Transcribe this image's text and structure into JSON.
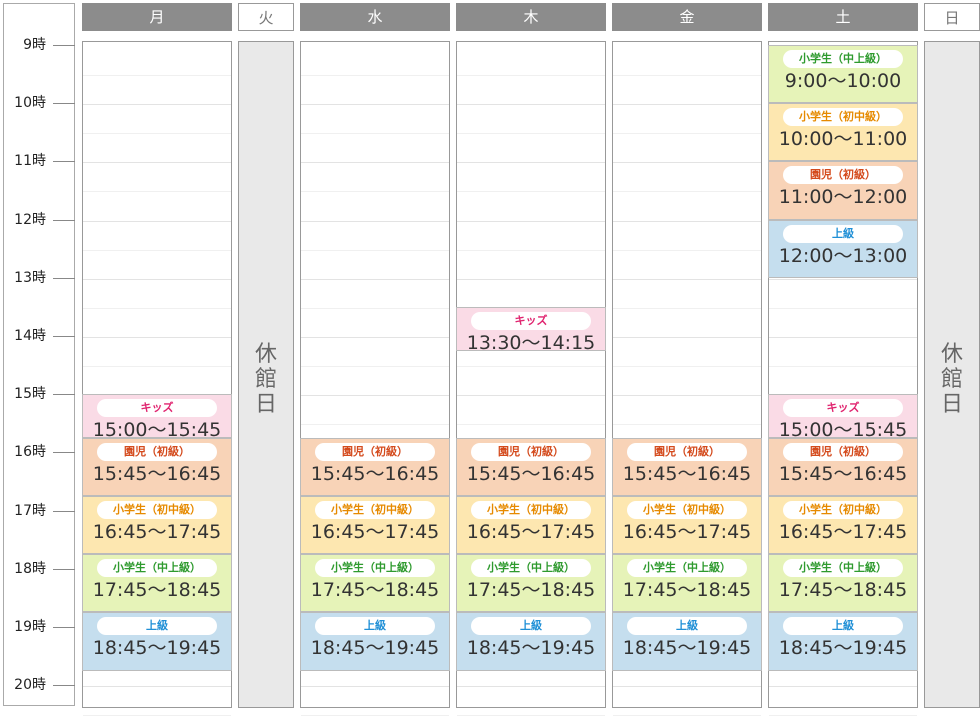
{
  "days": [
    {
      "label": "月",
      "closed": false
    },
    {
      "label": "火",
      "closed": true
    },
    {
      "label": "水",
      "closed": false
    },
    {
      "label": "木",
      "closed": false
    },
    {
      "label": "金",
      "closed": false
    },
    {
      "label": "土",
      "closed": false
    },
    {
      "label": "日",
      "closed": true
    }
  ],
  "hours": [
    "9時",
    "10時",
    "11時",
    "12時",
    "13時",
    "14時",
    "15時",
    "16時",
    "17時",
    "18時",
    "19時",
    "20時"
  ],
  "closed_label": "休館日",
  "classes": {
    "kids": {
      "label": "キッズ",
      "color": "#fadbe6",
      "text_color": "#e0246f"
    },
    "enji": {
      "label": "園児（初級）",
      "color": "#f8d3b7",
      "text_color": "#d44a1c"
    },
    "shochu": {
      "label": "小学生（初中級）",
      "color": "#fde7b0",
      "text_color": "#e68a00"
    },
    "chujo": {
      "label": "小学生（中上級）",
      "color": "#e6f3b8",
      "text_color": "#2e9a2e"
    },
    "jokyu": {
      "label": "上級",
      "color": "#c5deee",
      "text_color": "#1f8fd6"
    }
  },
  "schedule": [
    {
      "day": 0,
      "class": "kids",
      "start": "15:00",
      "end": "15:45",
      "time": "15:00〜15:45"
    },
    {
      "day": 0,
      "class": "enji",
      "start": "15:45",
      "end": "16:45",
      "time": "15:45〜16:45"
    },
    {
      "day": 0,
      "class": "shochu",
      "start": "16:45",
      "end": "17:45",
      "time": "16:45〜17:45"
    },
    {
      "day": 0,
      "class": "chujo",
      "start": "17:45",
      "end": "18:45",
      "time": "17:45〜18:45"
    },
    {
      "day": 0,
      "class": "jokyu",
      "start": "18:45",
      "end": "19:45",
      "time": "18:45〜19:45"
    },
    {
      "day": 2,
      "class": "enji",
      "start": "15:45",
      "end": "16:45",
      "time": "15:45〜16:45"
    },
    {
      "day": 2,
      "class": "shochu",
      "start": "16:45",
      "end": "17:45",
      "time": "16:45〜17:45"
    },
    {
      "day": 2,
      "class": "chujo",
      "start": "17:45",
      "end": "18:45",
      "time": "17:45〜18:45"
    },
    {
      "day": 2,
      "class": "jokyu",
      "start": "18:45",
      "end": "19:45",
      "time": "18:45〜19:45"
    },
    {
      "day": 3,
      "class": "kids",
      "start": "13:30",
      "end": "14:15",
      "time": "13:30〜14:15"
    },
    {
      "day": 3,
      "class": "enji",
      "start": "15:45",
      "end": "16:45",
      "time": "15:45〜16:45"
    },
    {
      "day": 3,
      "class": "shochu",
      "start": "16:45",
      "end": "17:45",
      "time": "16:45〜17:45"
    },
    {
      "day": 3,
      "class": "chujo",
      "start": "17:45",
      "end": "18:45",
      "time": "17:45〜18:45"
    },
    {
      "day": 3,
      "class": "jokyu",
      "start": "18:45",
      "end": "19:45",
      "time": "18:45〜19:45"
    },
    {
      "day": 4,
      "class": "enji",
      "start": "15:45",
      "end": "16:45",
      "time": "15:45〜16:45"
    },
    {
      "day": 4,
      "class": "shochu",
      "start": "16:45",
      "end": "17:45",
      "time": "16:45〜17:45"
    },
    {
      "day": 4,
      "class": "chujo",
      "start": "17:45",
      "end": "18:45",
      "time": "17:45〜18:45"
    },
    {
      "day": 4,
      "class": "jokyu",
      "start": "18:45",
      "end": "19:45",
      "time": "18:45〜19:45"
    },
    {
      "day": 5,
      "class": "chujo",
      "start": "9:00",
      "end": "10:00",
      "time": "9:00〜10:00"
    },
    {
      "day": 5,
      "class": "shochu",
      "start": "10:00",
      "end": "11:00",
      "time": "10:00〜11:00"
    },
    {
      "day": 5,
      "class": "enji",
      "start": "11:00",
      "end": "12:00",
      "time": "11:00〜12:00"
    },
    {
      "day": 5,
      "class": "jokyu",
      "start": "12:00",
      "end": "13:00",
      "time": "12:00〜13:00"
    },
    {
      "day": 5,
      "class": "kids",
      "start": "15:00",
      "end": "15:45",
      "time": "15:00〜15:45"
    },
    {
      "day": 5,
      "class": "enji",
      "start": "15:45",
      "end": "16:45",
      "time": "15:45〜16:45"
    },
    {
      "day": 5,
      "class": "shochu",
      "start": "16:45",
      "end": "17:45",
      "time": "16:45〜17:45"
    },
    {
      "day": 5,
      "class": "chujo",
      "start": "17:45",
      "end": "18:45",
      "time": "17:45〜18:45"
    },
    {
      "day": 5,
      "class": "jokyu",
      "start": "18:45",
      "end": "19:45",
      "time": "18:45〜19:45"
    }
  ]
}
